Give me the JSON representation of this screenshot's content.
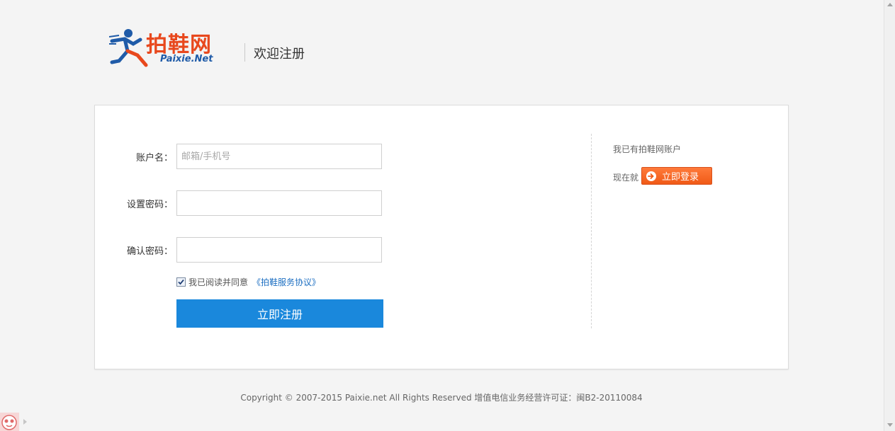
{
  "header": {
    "logo_cn": "拍鞋网",
    "logo_en": "Paixie.Net",
    "welcome": "欢迎注册"
  },
  "form": {
    "username": {
      "label": "账户名：",
      "placeholder": "邮箱/手机号",
      "value": ""
    },
    "password": {
      "label": "设置密码：",
      "value": ""
    },
    "confirm_password": {
      "label": "确认密码：",
      "value": ""
    },
    "agree": {
      "checked": true,
      "text": "我已阅读并同意",
      "link": "《拍鞋服务协议》"
    },
    "submit_label": "立即注册"
  },
  "side": {
    "have_account": "我已有拍鞋网账户",
    "now": "现在就",
    "login_label": "立即登录"
  },
  "footer": {
    "copyright": "Copyright © 2007-2015 Paixie.net All Rights Reserved 增值电信业务经营许可证：闽B2-20110084"
  },
  "colors": {
    "brand_orange": "#e8481d",
    "brand_blue": "#1f5ba8",
    "primary_button": "#1a88dc",
    "login_button": "#f05a17",
    "link": "#1d6fc2"
  }
}
